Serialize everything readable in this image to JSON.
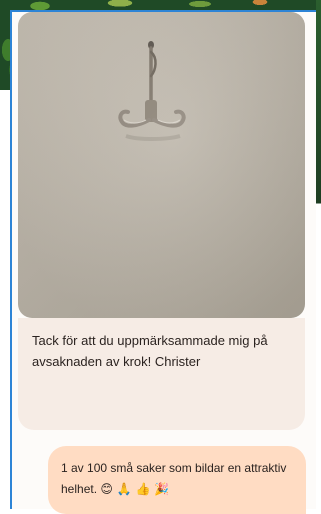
{
  "message": {
    "photo_alt": "hook-photo",
    "caption_text": "Tack för att du uppmärksammade mig på avsaknaden av krok! Christer"
  },
  "reply": {
    "text": "1 av 100 små saker som bildar en attraktiv helhet.",
    "emojis": "😊 🙏 👍 🎉"
  },
  "colors": {
    "panel_border": "#2d84d6",
    "caption_bg": "#f6ece5",
    "reply_bg": "#ffdcc3"
  }
}
